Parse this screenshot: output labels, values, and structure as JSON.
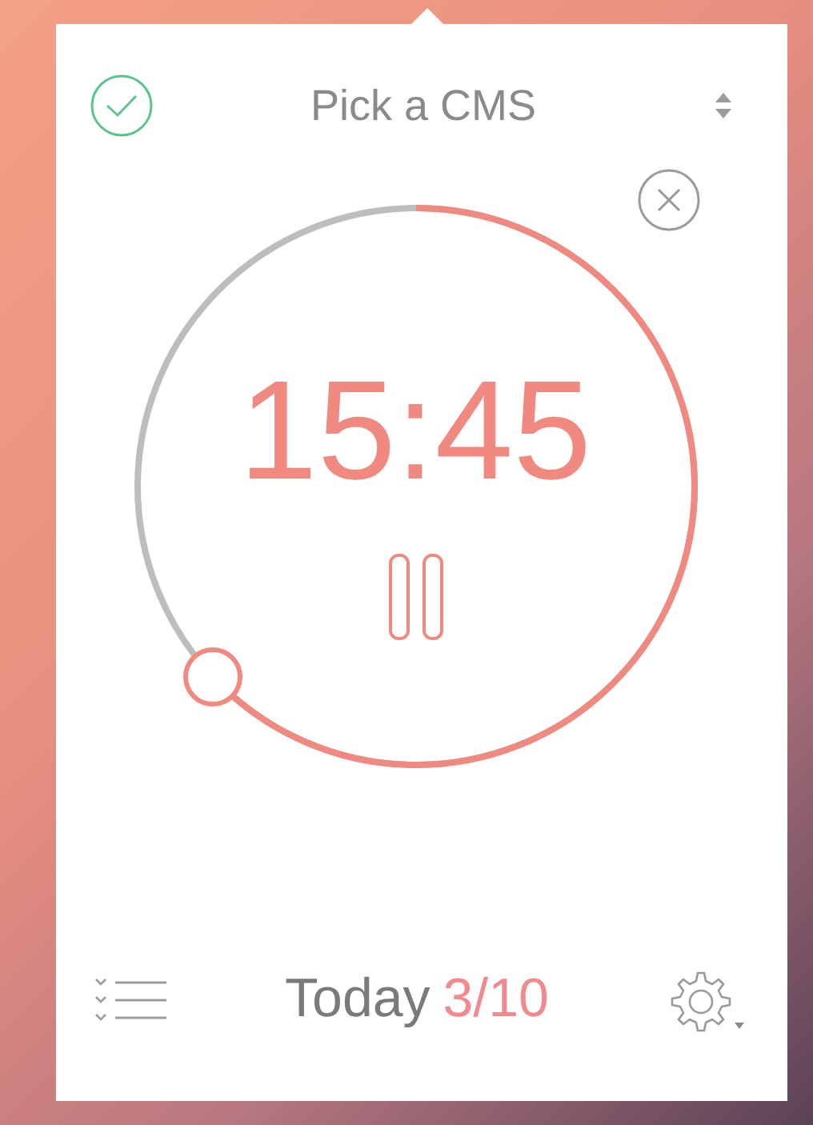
{
  "header": {
    "task_title": "Pick a CMS"
  },
  "timer": {
    "time": "15:45",
    "level": 0.63,
    "running": true
  },
  "footer": {
    "label": "Today",
    "count": "3/10"
  }
}
